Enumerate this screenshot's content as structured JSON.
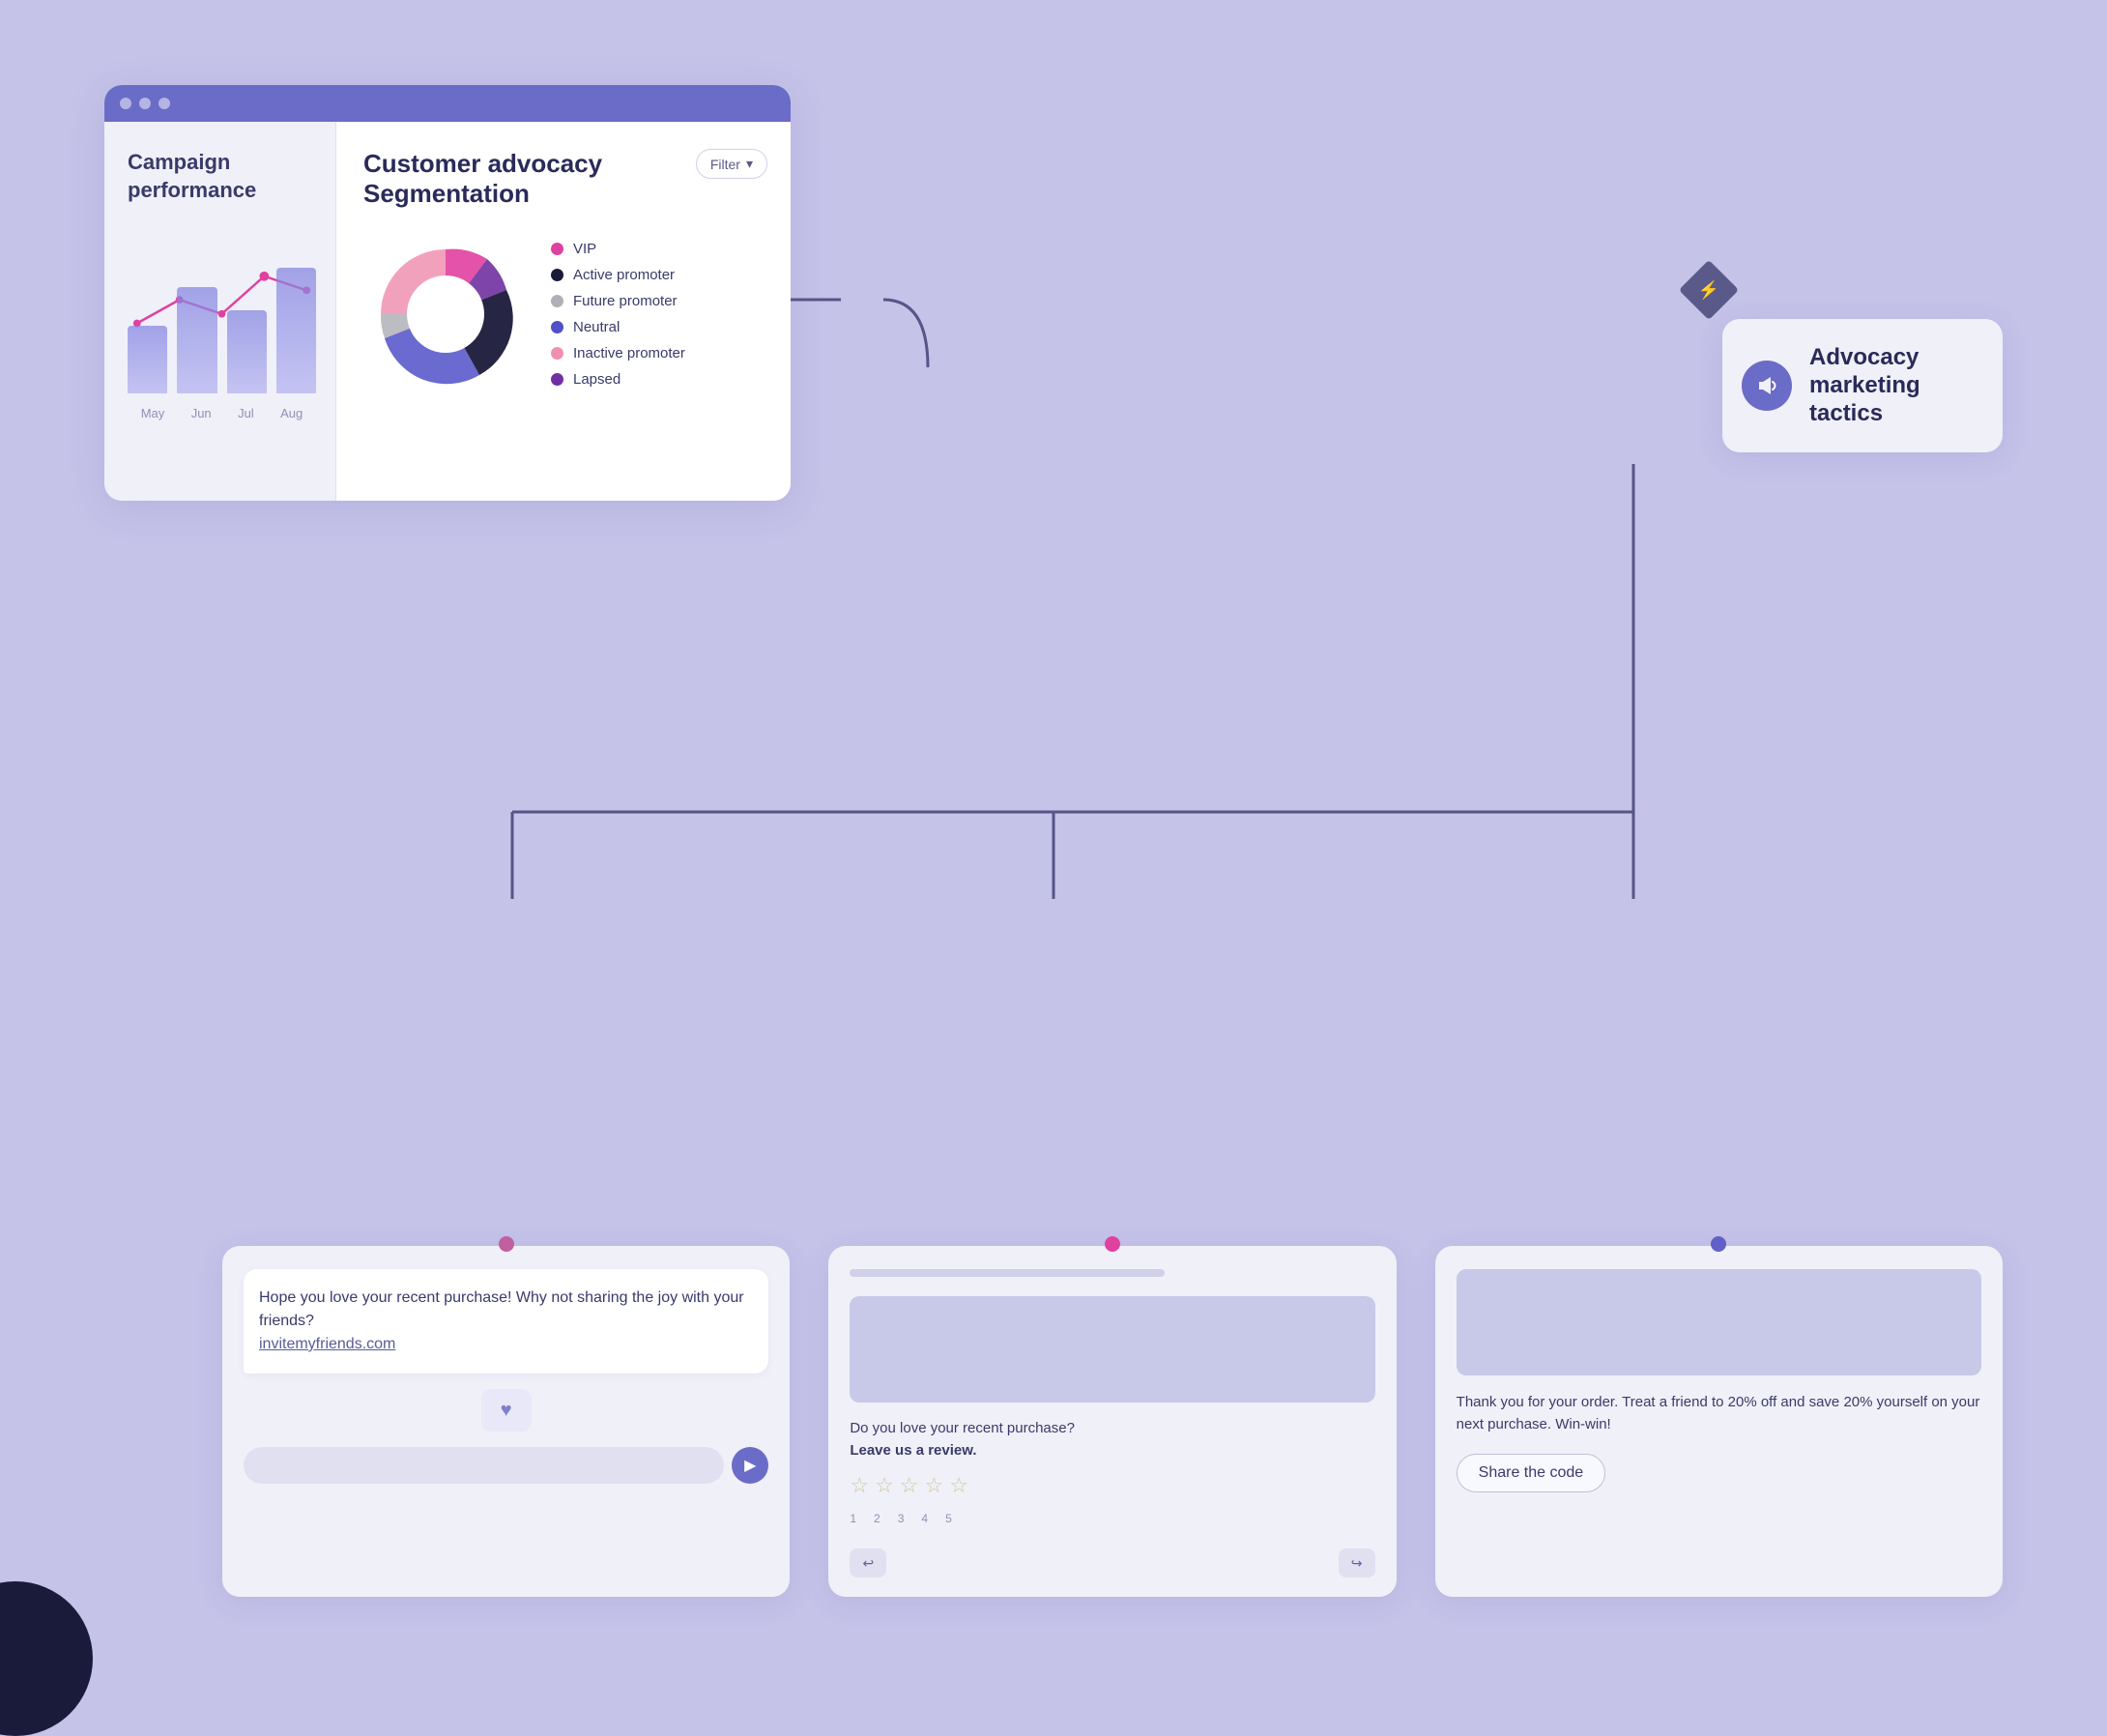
{
  "background_color": "#c5c3e8",
  "browser": {
    "titlebar_color": "#6b6bc8",
    "dots": [
      "circle1",
      "circle2",
      "circle3"
    ],
    "campaign": {
      "title": "Campaign performance",
      "bars": [
        {
          "month": "May",
          "height": 70
        },
        {
          "month": "Jun",
          "height": 110
        },
        {
          "month": "Jul",
          "height": 85
        },
        {
          "month": "Aug",
          "height": 130
        }
      ],
      "months": [
        "May",
        "Jun",
        "Jul",
        "Aug"
      ]
    },
    "advocacy": {
      "title": "Customer advocacy Segmentation",
      "filter_label": "Filter",
      "legend": [
        {
          "label": "VIP",
          "color": "#e040a0"
        },
        {
          "label": "Active promoter",
          "color": "#1a1a3a"
        },
        {
          "label": "Future promoter",
          "color": "#b0b0b8"
        },
        {
          "label": "Neutral",
          "color": "#5050c8"
        },
        {
          "label": "Inactive promoter",
          "color": "#f090b0"
        },
        {
          "label": "Lapsed",
          "color": "#7030a0"
        }
      ]
    }
  },
  "tactics_box": {
    "title": "Advocacy marketing tactics",
    "icon": "megaphone"
  },
  "cards": [
    {
      "type": "message",
      "message_text": "Hope you love your recent purchase! Why not sharing the joy with your friends?",
      "message_link": "invitemyfriends.com",
      "dot_color": "#c060a0"
    },
    {
      "type": "review",
      "question": "Do you love your recent purchase?",
      "cta": "Leave us a review.",
      "stars": [
        "☆",
        "☆",
        "☆",
        "☆",
        "☆"
      ],
      "star_labels": [
        "1",
        "2",
        "3",
        "4",
        "5"
      ],
      "dot_color": "#e040a0"
    },
    {
      "type": "share",
      "text": "Thank you for your order. Treat a friend to 20% off and save 20% yourself on your next purchase. Win-win!",
      "button_label": "Share the code",
      "dot_color": "#6060c8"
    }
  ],
  "diamond_icon": "⚡"
}
